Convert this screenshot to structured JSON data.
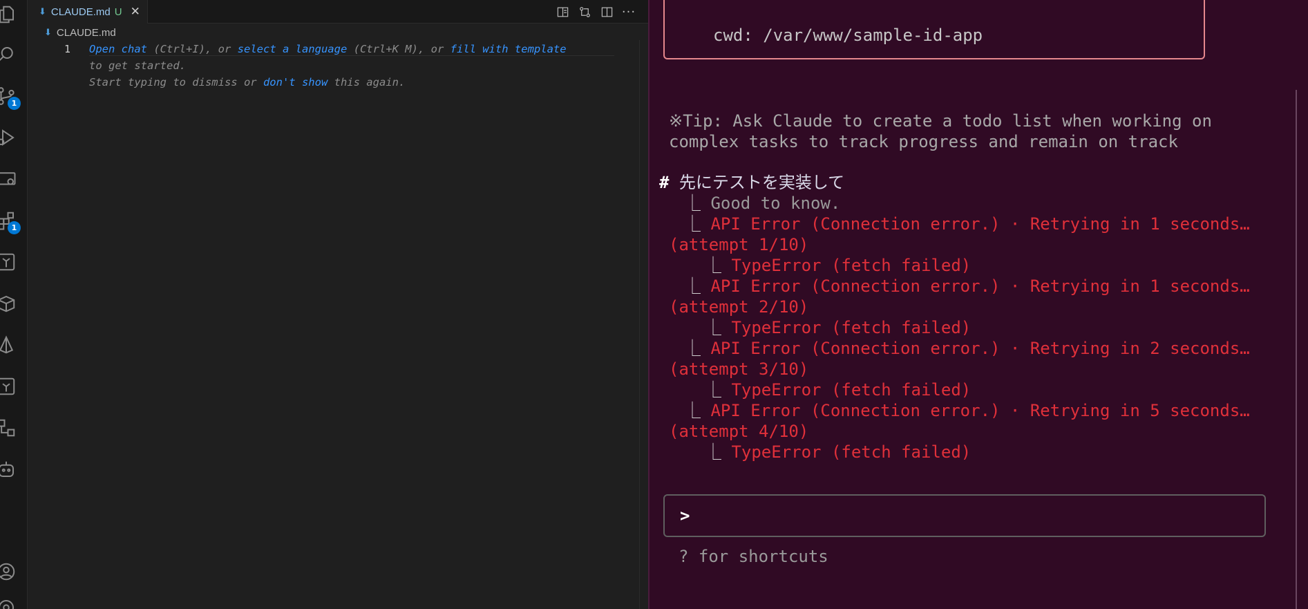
{
  "editor": {
    "tab": {
      "title": "CLAUDE.md",
      "modified_marker": "U",
      "close_glyph": "✕"
    },
    "breadcrumb": "CLAUDE.md",
    "line_number": "1",
    "hint": {
      "open_chat": "Open chat",
      "open_chat_key": " (Ctrl+I), or ",
      "select_language": "select a language",
      "select_language_key": " (Ctrl+K M), or ",
      "fill_template": "fill with template",
      "line2": "to get started.",
      "dismiss_prefix": "Start typing to dismiss or ",
      "dont_show": "don't show",
      "dismiss_suffix": " this again."
    },
    "more_actions": "···"
  },
  "activity_bar": {
    "icons": [
      "explorer-icon",
      "search-icon",
      "source-control-icon",
      "run-debug-icon",
      "remote-explorer-icon",
      "extensions-icon",
      "terraform-icon",
      "containers-icon",
      "prisma-icon",
      "terraform-cloud-icon",
      "diagram-icon",
      "copilot-icon",
      "account-icon",
      "settings-icon"
    ],
    "badges": {
      "source_control": "1",
      "extensions": "1"
    }
  },
  "terminal": {
    "cwd": "cwd: /var/www/sample-id-app",
    "tip_line1": "※Tip: Ask Claude to create a todo list when working on",
    "tip_line2": "complex tasks to track progress and remain on track",
    "heading_hash": "#",
    "heading_text": " 先にテストを実装して",
    "tree_glyph": "⎿",
    "good_to_know": "Good to know.",
    "errors": [
      {
        "message": "API Error (Connection error.) · Retrying in 1 seconds…",
        "attempt": "(attempt 1/10)",
        "detail": "TypeError (fetch failed)"
      },
      {
        "message": "API Error (Connection error.) · Retrying in 1 seconds…",
        "attempt": "(attempt 2/10)",
        "detail": "TypeError (fetch failed)"
      },
      {
        "message": "API Error (Connection error.) · Retrying in 2 seconds…",
        "attempt": "(attempt 3/10)",
        "detail": "TypeError (fetch failed)"
      },
      {
        "message": "API Error (Connection error.) · Retrying in 5 seconds…",
        "attempt": "(attempt 4/10)",
        "detail": "TypeError (fetch failed)"
      }
    ],
    "prompt": ">",
    "shortcuts_hint": "? for shortcuts"
  },
  "colors": {
    "terminal_bg": "#300a24",
    "error": "#e0303a",
    "accent_link": "#3794ff",
    "badge": "#0078d4",
    "cwd_border": "#e5878d"
  }
}
